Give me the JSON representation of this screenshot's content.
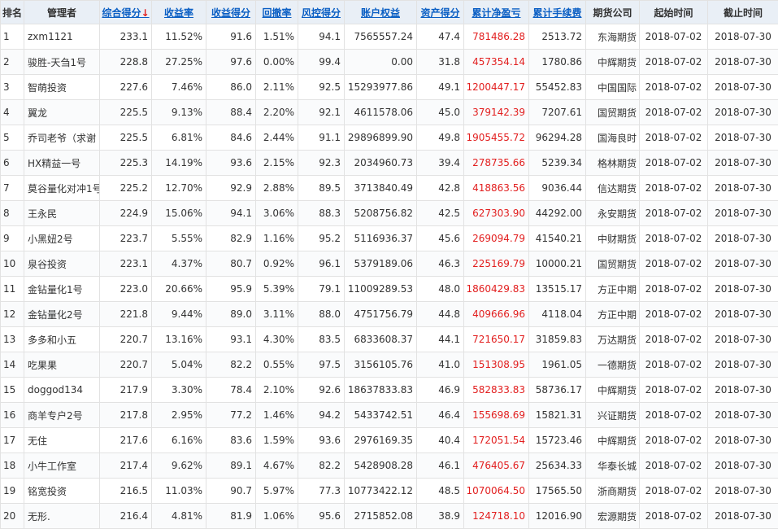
{
  "columns": [
    {
      "key": "rank",
      "label": "排名",
      "sortable": false
    },
    {
      "key": "manager",
      "label": "管理者",
      "sortable": false
    },
    {
      "key": "total_score",
      "label": "综合得分",
      "sortable": true,
      "sort_indicator": "↓"
    },
    {
      "key": "return_rate",
      "label": "收益率",
      "sortable": true
    },
    {
      "key": "return_score",
      "label": "收益得分",
      "sortable": true
    },
    {
      "key": "drawdown",
      "label": "回撤率",
      "sortable": true
    },
    {
      "key": "risk_score",
      "label": "风控得分",
      "sortable": true
    },
    {
      "key": "equity",
      "label": "账户权益",
      "sortable": true
    },
    {
      "key": "asset_score",
      "label": "资产得分",
      "sortable": true
    },
    {
      "key": "net_pnl",
      "label": "累计净盈亏",
      "sortable": true
    },
    {
      "key": "fees",
      "label": "累计手续费",
      "sortable": true
    },
    {
      "key": "broker",
      "label": "期货公司",
      "sortable": false
    },
    {
      "key": "start",
      "label": "起始时间",
      "sortable": false
    },
    {
      "key": "end",
      "label": "截止时间",
      "sortable": false
    }
  ],
  "rows": [
    [
      "1",
      "zxm1121",
      "233.1",
      "11.52%",
      "91.6",
      "1.51%",
      "94.1",
      "7565557.24",
      "47.4",
      "781486.28",
      "2513.72",
      "东海期货",
      "2018-07-02",
      "2018-07-30"
    ],
    [
      "2",
      "骏胜-天刍1号",
      "228.8",
      "27.25%",
      "97.6",
      "0.00%",
      "99.4",
      "0.00",
      "31.8",
      "457354.14",
      "1780.86",
      "中辉期货",
      "2018-07-02",
      "2018-07-30"
    ],
    [
      "3",
      "智萌投资",
      "227.6",
      "7.46%",
      "86.0",
      "2.11%",
      "92.5",
      "15293977.86",
      "49.1",
      "1200447.17",
      "55452.83",
      "中国国际",
      "2018-07-02",
      "2018-07-30"
    ],
    [
      "4",
      "翼龙",
      "225.5",
      "9.13%",
      "88.4",
      "2.20%",
      "92.1",
      "4611578.06",
      "45.0",
      "379142.39",
      "7207.61",
      "国贸期货",
      "2018-07-02",
      "2018-07-30"
    ],
    [
      "5",
      "乔司老爷（求谢",
      "225.5",
      "6.81%",
      "84.6",
      "2.44%",
      "91.1",
      "29896899.90",
      "49.8",
      "1905455.72",
      "96294.28",
      "国海良时",
      "2018-07-02",
      "2018-07-30"
    ],
    [
      "6",
      "HX精益一号",
      "225.3",
      "14.19%",
      "93.6",
      "2.15%",
      "92.3",
      "2034960.73",
      "39.4",
      "278735.66",
      "5239.34",
      "格林期货",
      "2018-07-02",
      "2018-07-30"
    ],
    [
      "7",
      "莫谷量化对冲1号",
      "225.2",
      "12.70%",
      "92.9",
      "2.88%",
      "89.5",
      "3713840.49",
      "42.8",
      "418863.56",
      "9036.44",
      "信达期货",
      "2018-07-02",
      "2018-07-30"
    ],
    [
      "8",
      "王永民",
      "224.9",
      "15.06%",
      "94.1",
      "3.06%",
      "88.3",
      "5208756.82",
      "42.5",
      "627303.90",
      "44292.00",
      "永安期货",
      "2018-07-02",
      "2018-07-30"
    ],
    [
      "9",
      "小黑妞2号",
      "223.7",
      "5.55%",
      "82.9",
      "1.16%",
      "95.2",
      "5116936.37",
      "45.6",
      "269094.79",
      "41540.21",
      "中财期货",
      "2018-07-02",
      "2018-07-30"
    ],
    [
      "10",
      "泉谷投资",
      "223.1",
      "4.37%",
      "80.7",
      "0.92%",
      "96.1",
      "5379189.06",
      "46.3",
      "225169.79",
      "10000.21",
      "国贸期货",
      "2018-07-02",
      "2018-07-30"
    ],
    [
      "11",
      "金钻量化1号",
      "223.0",
      "20.66%",
      "95.9",
      "5.39%",
      "79.1",
      "11009289.53",
      "48.0",
      "1860429.83",
      "13515.17",
      "方正中期",
      "2018-07-02",
      "2018-07-30"
    ],
    [
      "12",
      "金钻量化2号",
      "221.8",
      "9.44%",
      "89.0",
      "3.11%",
      "88.0",
      "4751756.79",
      "44.8",
      "409666.96",
      "4118.04",
      "方正中期",
      "2018-07-02",
      "2018-07-30"
    ],
    [
      "13",
      "多多和小五",
      "220.7",
      "13.16%",
      "93.1",
      "4.30%",
      "83.5",
      "6833608.37",
      "44.1",
      "721650.17",
      "31859.83",
      "万达期货",
      "2018-07-02",
      "2018-07-30"
    ],
    [
      "14",
      "吃果果",
      "220.7",
      "5.04%",
      "82.2",
      "0.55%",
      "97.5",
      "3156105.76",
      "41.0",
      "151308.95",
      "1961.05",
      "一德期货",
      "2018-07-02",
      "2018-07-30"
    ],
    [
      "15",
      "doggod134",
      "217.9",
      "3.30%",
      "78.4",
      "2.10%",
      "92.6",
      "18637833.83",
      "46.9",
      "582833.83",
      "58736.17",
      "中辉期货",
      "2018-07-02",
      "2018-07-30"
    ],
    [
      "16",
      "商羊专户2号",
      "217.8",
      "2.95%",
      "77.2",
      "1.46%",
      "94.2",
      "5433742.51",
      "46.4",
      "155698.69",
      "15821.31",
      "兴证期货",
      "2018-07-02",
      "2018-07-30"
    ],
    [
      "17",
      "无住",
      "217.6",
      "6.16%",
      "83.6",
      "1.59%",
      "93.6",
      "2976169.35",
      "40.4",
      "172051.54",
      "15723.46",
      "中辉期货",
      "2018-07-02",
      "2018-07-30"
    ],
    [
      "18",
      "小牛工作室",
      "217.4",
      "9.62%",
      "89.1",
      "4.67%",
      "82.2",
      "5428908.28",
      "46.1",
      "476405.67",
      "25634.33",
      "华泰长城",
      "2018-07-02",
      "2018-07-30"
    ],
    [
      "19",
      "铭宽投资",
      "216.5",
      "11.03%",
      "90.7",
      "5.97%",
      "77.3",
      "10773422.12",
      "48.5",
      "1070064.50",
      "17565.50",
      "浙商期货",
      "2018-07-02",
      "2018-07-30"
    ],
    [
      "20",
      "无形.",
      "216.4",
      "4.81%",
      "81.9",
      "1.06%",
      "95.6",
      "2715852.08",
      "38.9",
      "124718.10",
      "12016.90",
      "宏源期货",
      "2018-07-02",
      "2018-07-30"
    ]
  ],
  "colors": {
    "header_bg": "#e9eff6",
    "link": "#0b5fc4",
    "negative_or_pnl": "#e21e1e",
    "border": "#e2e2e2"
  }
}
